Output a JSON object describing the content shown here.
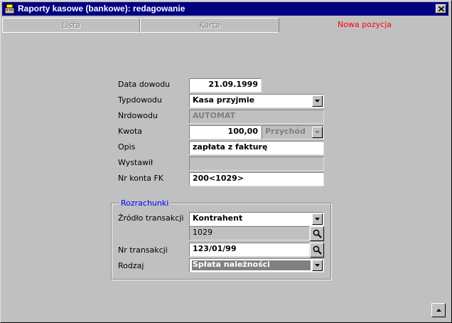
{
  "window": {
    "title": "Raporty kasowe (bankowe): redagowanie",
    "icon": "cash-register-icon",
    "close_icon": "close-icon"
  },
  "tabs": [
    {
      "label": "Lista",
      "active": false
    },
    {
      "label": "Karta",
      "active": false
    },
    {
      "label": "Nowa pozycja",
      "active": true
    }
  ],
  "form": {
    "data_dowodu": {
      "label": "Data dowodu",
      "value": "21.09.1999"
    },
    "typ_dowodu": {
      "label": "Typdowodu",
      "value": "Kasa przyjmie"
    },
    "nr_dowodu": {
      "label": "Nrdowodu",
      "value": "AUTOMAT"
    },
    "kwota": {
      "label": "Kwota",
      "value": "100,00",
      "direction": "Przychód"
    },
    "opis": {
      "label": "Opis",
      "value": "zapłata z fakturę"
    },
    "wystawil": {
      "label": "Wystawił",
      "value": ""
    },
    "nr_konta_fk": {
      "label": "Nr konta FK",
      "value": "200<1029>"
    }
  },
  "rozrachunki": {
    "title": "Rozrachunki",
    "zrodlo": {
      "label": "Źródło transakcji",
      "value": "Kontrahent",
      "code": "1029"
    },
    "nr_transakcji": {
      "label": "Nr transakcji",
      "value": "123/01/99"
    },
    "rodzaj": {
      "label": "Rodzaj",
      "value": "Spłata należności"
    }
  },
  "colors": {
    "titlebar": "#000080",
    "active_tab": "#ff0000",
    "group_title": "#0000ff",
    "face": "#c0c0c0"
  }
}
